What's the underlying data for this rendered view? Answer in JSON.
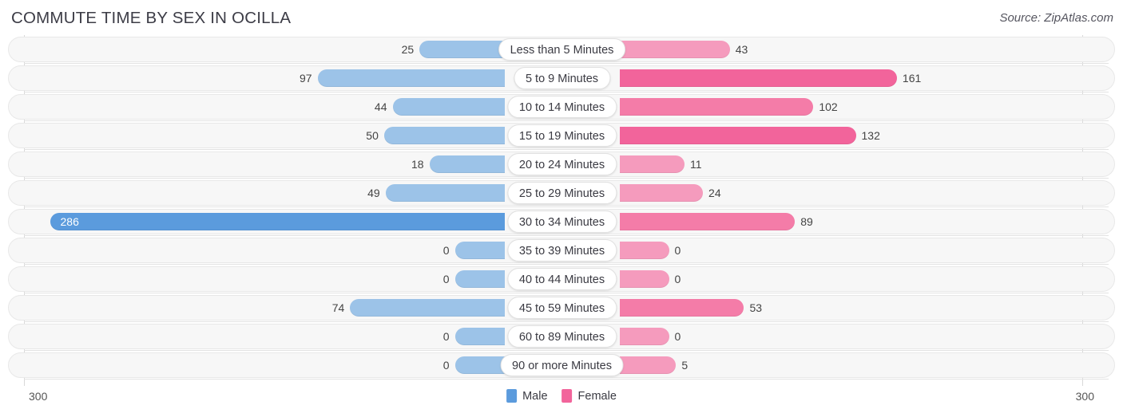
{
  "header": {
    "title": "COMMUTE TIME BY SEX IN OCILLA",
    "source": "Source: ZipAtlas.com"
  },
  "axis": {
    "left_tick": "300",
    "right_tick": "300",
    "max": 300
  },
  "legend": {
    "items": [
      {
        "label": "Male",
        "color": "#5b9bdd"
      },
      {
        "label": "Female",
        "color": "#f2649b"
      }
    ]
  },
  "colors": {
    "male": "#9cc3e8",
    "male_max": "#5b9bdd",
    "female": "#f59bbd",
    "female_mid": "#f47ca8",
    "female_max": "#f2649b",
    "track": "#f7f7f7",
    "pill": "#ffffff"
  },
  "chart_data": {
    "type": "bar",
    "subtype": "diverging-bidirectional",
    "title": "COMMUTE TIME BY SEX IN OCILLA",
    "xlabel": "",
    "ylabel": "",
    "xlim": [
      300,
      300
    ],
    "grid": false,
    "legend_position": "bottom-center",
    "categories": [
      "Less than 5 Minutes",
      "5 to 9 Minutes",
      "10 to 14 Minutes",
      "15 to 19 Minutes",
      "20 to 24 Minutes",
      "25 to 29 Minutes",
      "30 to 34 Minutes",
      "35 to 39 Minutes",
      "40 to 44 Minutes",
      "45 to 59 Minutes",
      "60 to 89 Minutes",
      "90 or more Minutes"
    ],
    "series": [
      {
        "name": "Male",
        "side": "left",
        "values": [
          25,
          97,
          44,
          50,
          18,
          49,
          286,
          0,
          0,
          74,
          0,
          0
        ]
      },
      {
        "name": "Female",
        "side": "right",
        "values": [
          43,
          161,
          102,
          132,
          11,
          24,
          89,
          0,
          0,
          53,
          0,
          5
        ]
      }
    ],
    "rows": [
      {
        "label": "Less than 5 Minutes",
        "male": 25,
        "female": 43,
        "male_display": "25",
        "female_display": "43",
        "male_rank": "low",
        "female_rank": "low"
      },
      {
        "label": "5 to 9 Minutes",
        "male": 97,
        "female": 161,
        "male_display": "97",
        "female_display": "161",
        "male_rank": "low",
        "female_rank": "max"
      },
      {
        "label": "10 to 14 Minutes",
        "male": 44,
        "female": 102,
        "male_display": "44",
        "female_display": "102",
        "male_rank": "low",
        "female_rank": "mid"
      },
      {
        "label": "15 to 19 Minutes",
        "male": 50,
        "female": 132,
        "male_display": "50",
        "female_display": "132",
        "male_rank": "low",
        "female_rank": "max"
      },
      {
        "label": "20 to 24 Minutes",
        "male": 18,
        "female": 11,
        "male_display": "18",
        "female_display": "11",
        "male_rank": "low",
        "female_rank": "low"
      },
      {
        "label": "25 to 29 Minutes",
        "male": 49,
        "female": 24,
        "male_display": "49",
        "female_display": "24",
        "male_rank": "low",
        "female_rank": "low"
      },
      {
        "label": "30 to 34 Minutes",
        "male": 286,
        "female": 89,
        "male_display": "286",
        "female_display": "89",
        "male_rank": "max",
        "female_rank": "mid"
      },
      {
        "label": "35 to 39 Minutes",
        "male": 0,
        "female": 0,
        "male_display": "0",
        "female_display": "0",
        "male_rank": "low",
        "female_rank": "low"
      },
      {
        "label": "40 to 44 Minutes",
        "male": 0,
        "female": 0,
        "male_display": "0",
        "female_display": "0",
        "male_rank": "low",
        "female_rank": "low"
      },
      {
        "label": "45 to 59 Minutes",
        "male": 74,
        "female": 53,
        "male_display": "74",
        "female_display": "53",
        "male_rank": "low",
        "female_rank": "mid"
      },
      {
        "label": "60 to 89 Minutes",
        "male": 0,
        "female": 0,
        "male_display": "0",
        "female_display": "0",
        "male_rank": "low",
        "female_rank": "low"
      },
      {
        "label": "90 or more Minutes",
        "male": 0,
        "female": 5,
        "male_display": "0",
        "female_display": "5",
        "male_rank": "low",
        "female_rank": "low"
      }
    ]
  }
}
